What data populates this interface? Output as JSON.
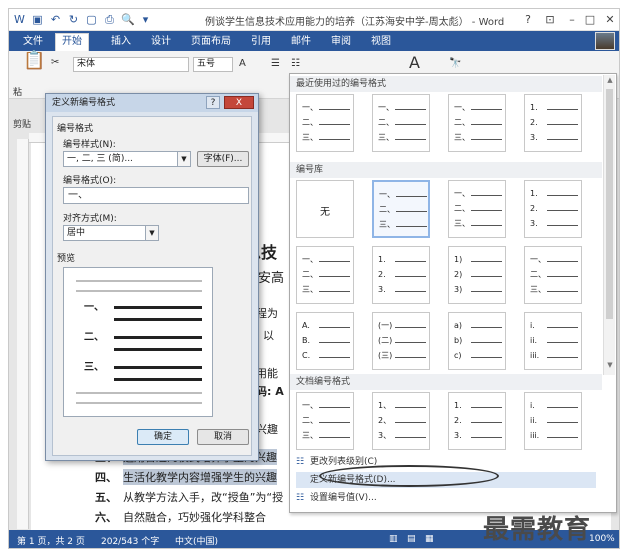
{
  "titlebar": {
    "doc_title": "例谈学生信息技术应用能力的培养（江苏海安中学-周太彪） - Word",
    "help": "?",
    "restore": "⊡",
    "minimize": "–",
    "maximize": "□",
    "close": "✕"
  },
  "ribbon": {
    "tabs": [
      "文件",
      "开始",
      "插入",
      "设计",
      "页面布局",
      "引用",
      "邮件",
      "审阅",
      "视图"
    ],
    "font_name": "宋体",
    "font_size": "五号",
    "paste_label": "粘",
    "clipboard_label": "剪贴"
  },
  "numbering_panel": {
    "recent_header": "最近使用过的编号格式",
    "library_header": "编号库",
    "document_header": "文档编号格式",
    "none_label": "无",
    "menu": {
      "change_level": "更改列表级别(C)",
      "define_new": "定义新编号格式(D)...",
      "set_value": "设置编号值(V)..."
    },
    "recent_cells": [
      [
        "一、",
        "二、",
        "三、"
      ],
      [
        "一、",
        "二、",
        "三、"
      ],
      [
        "一、",
        "二、",
        "三、"
      ],
      [
        "1.",
        "2.",
        "3."
      ]
    ],
    "library_cells": [
      [
        "一、",
        "二、",
        "三、"
      ],
      [
        "一、",
        "二、",
        "三、"
      ],
      [
        "1.",
        "2.",
        "3."
      ],
      [
        "一、",
        "二、",
        "三、"
      ],
      [
        "1.",
        "2.",
        "3."
      ],
      [
        "1)",
        "2)",
        "3)"
      ],
      [
        "一、",
        "二、",
        "三、"
      ],
      [
        "A.",
        "B.",
        "C."
      ],
      [
        "(一)",
        "(二)",
        "(三)"
      ],
      [
        "a)",
        "b)",
        "c)"
      ],
      [
        "i.",
        "ii.",
        "iii."
      ]
    ],
    "document_cells": [
      [
        "一、",
        "二、",
        "三、"
      ],
      [
        "1、",
        "2、",
        "3、"
      ],
      [
        "1.",
        "2.",
        "3."
      ],
      [
        "i.",
        "ii.",
        "iii."
      ]
    ]
  },
  "dialog": {
    "title": "定义新编号格式",
    "help_btn": "?",
    "close_btn": "X",
    "group_label": "编号格式",
    "style_label": "编号样式(N):",
    "style_value": "一, 二, 三 (简)...",
    "font_btn": "字体(F)...",
    "format_label": "编号格式(O):",
    "format_value": "一、",
    "align_label": "对齐方式(M):",
    "align_value": "居中",
    "preview_label": "预览",
    "preview_marks": [
      "一、",
      "二、",
      "三、"
    ],
    "ok": "确定",
    "cancel": "取消"
  },
  "document": {
    "heading_fragment": "息技",
    "subheading_fragment": "苏安高",
    "fragments": [
      "课程为",
      "面, 以",
      "应用能",
      "识码: A",
      "的兴趣"
    ],
    "list_items": [
      {
        "marker": "三、",
        "text": "运用合适的模式培养学生的兴趣",
        "highlight": true
      },
      {
        "marker": "四、",
        "text": "生活化教学内容增强学生的兴趣",
        "highlight": true
      },
      {
        "marker": "五、",
        "text": "从教学方法入手，改“授鱼”为“授",
        "highlight": false
      },
      {
        "marker": "六、",
        "text": "自然融合，巧妙强化学科整合",
        "highlight": false
      }
    ]
  },
  "statusbar": {
    "page": "第 1 页，共 2 页",
    "words": "202/543 个字",
    "lang": "中文(中国)",
    "zoom": "100%"
  },
  "watermark": "最需教育"
}
